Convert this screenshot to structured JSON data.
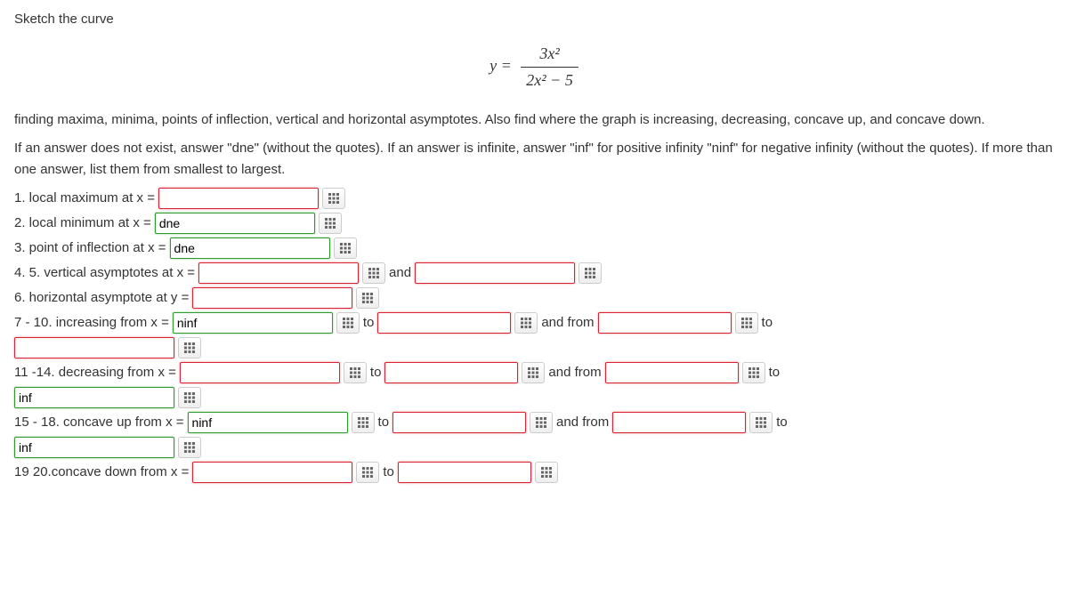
{
  "header": "Sketch the curve",
  "equation": {
    "lhs": "y =",
    "num": "3x²",
    "den": "2x² − 5"
  },
  "paragraph1": "finding maxima, minima, points of inflection, vertical and horizontal asymptotes. Also find where the graph is increasing, decreasing, concave up, and concave down.",
  "paragraph2": "If an answer does not exist, answer \"dne\" (without the quotes). If an answer is infinite, answer \"inf\" for positive infinity \"ninf\" for negative infinity (without the quotes). If more than one answer, list them from smallest to largest.",
  "q1": {
    "label": "1. local maximum at x =",
    "v": ""
  },
  "q2": {
    "label": "2. local minimum at x =",
    "v": "dne"
  },
  "q3": {
    "label": "3. point of inflection at x =",
    "v": "dne"
  },
  "q45": {
    "label": "4. 5. vertical asymptotes at x =",
    "and": "and",
    "v1": "",
    "v2": ""
  },
  "q6": {
    "label": "6. horizontal asymptote at y =",
    "v": ""
  },
  "q7": {
    "label": "7 - 10. increasing from x =",
    "v1": "ninf",
    "to": "to",
    "v2": "",
    "andfrom": "and from",
    "v3": "",
    "to2": "to",
    "v4": ""
  },
  "q11": {
    "label": "11 -14. decreasing from x =",
    "v1": "",
    "to": "to",
    "v2": "",
    "andfrom": "and from",
    "v3": "",
    "to2": "to",
    "v4": "inf"
  },
  "q15": {
    "label": "15 - 18. concave up from x =",
    "v1": "ninf",
    "to": "to",
    "v2": "",
    "andfrom": "and from",
    "v3": "",
    "to2": "to",
    "v4": "inf"
  },
  "q19": {
    "label": "19 20.concave down from x =",
    "v1": "",
    "to": "to",
    "v2": ""
  }
}
